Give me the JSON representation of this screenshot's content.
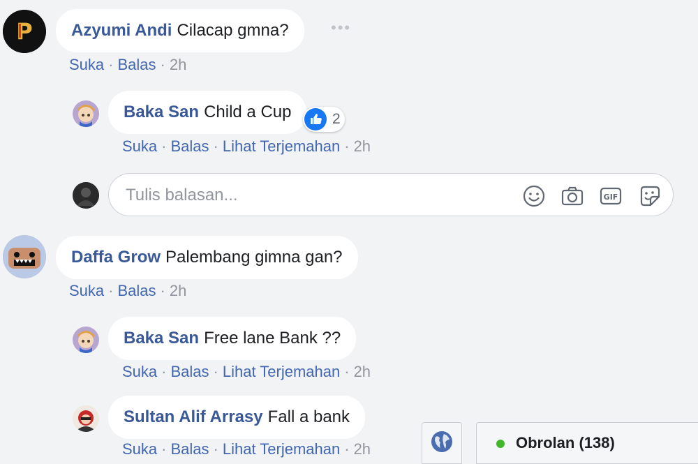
{
  "comments": [
    {
      "author": "Azyumi Andi",
      "text": "Cilacap gmna?",
      "actions": [
        "Suka",
        "Balas"
      ],
      "time": "2h"
    },
    {
      "author": "Baka San",
      "text": "Child a Cup",
      "actions": [
        "Suka",
        "Balas",
        "Lihat Terjemahan"
      ],
      "time": "2h",
      "reactions": "2"
    },
    {
      "author": "Daffa Grow",
      "text": "Palembang gimna gan?",
      "actions": [
        "Suka",
        "Balas"
      ],
      "time": "2h"
    },
    {
      "author": "Baka San",
      "text": "Free lane Bank ??",
      "actions": [
        "Suka",
        "Balas",
        "Lihat Terjemahan"
      ],
      "time": "2h"
    },
    {
      "author": "Sultan Alif Arrasy",
      "text": "Fall a bank",
      "actions": [
        "Suka",
        "Balas",
        "Lihat Terjemahan"
      ],
      "time": "2h"
    }
  ],
  "reply_box": {
    "placeholder": "Tulis balasan...",
    "tools": [
      "smiley-icon",
      "camera-icon",
      "gif-icon",
      "sticker-icon"
    ]
  },
  "chat": {
    "label": "Obrolan (138)",
    "status": "online"
  },
  "colors": {
    "name": "#385898",
    "link": "#4267b2",
    "meta": "#90949c",
    "bg": "#f2f3f5",
    "online": "#42b72a",
    "like": "#1877f2"
  }
}
